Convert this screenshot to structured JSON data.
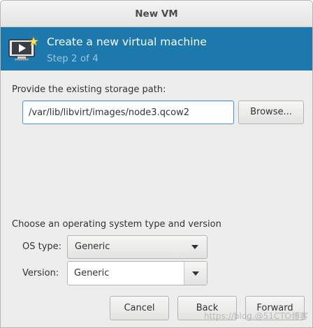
{
  "window": {
    "title": "New VM"
  },
  "banner": {
    "title": "Create a new virtual machine",
    "step": "Step 2 of 4",
    "icon": "monitor-play-icon",
    "background": "#1d78ad"
  },
  "storage": {
    "label": "Provide the existing storage path:",
    "path_value": "/var/lib/libvirt/images/node3.qcow2",
    "browse_label": "Browse..."
  },
  "os": {
    "section_label": "Choose an operating system type and version",
    "type_label": "OS type:",
    "type_value": "Generic",
    "version_label": "Version:",
    "version_value": "Generic"
  },
  "footer": {
    "cancel_label": "Cancel",
    "back_label": "Back",
    "forward_label": "Forward"
  },
  "watermark": "https://blog.@51CTO博客"
}
